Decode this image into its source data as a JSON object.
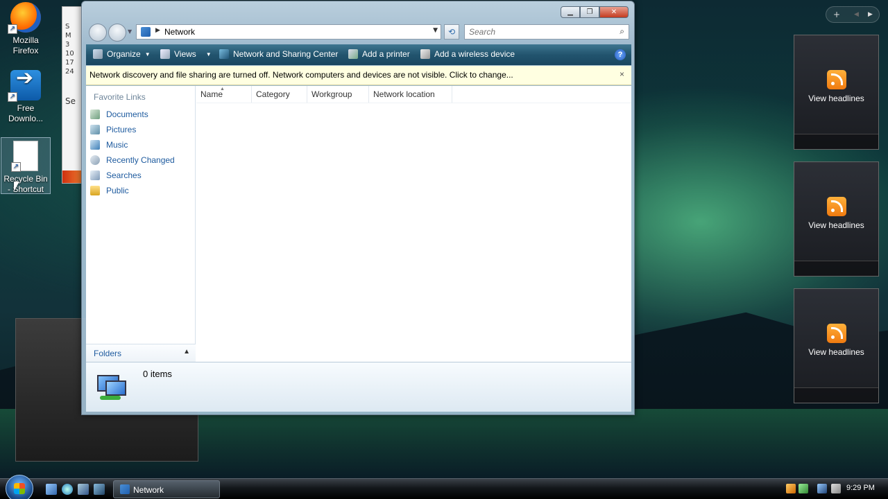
{
  "desktop": {
    "icons": [
      {
        "label": "Mozilla Firefox"
      },
      {
        "label": "Free Downlo..."
      },
      {
        "label": "Recycle Bin - Shortcut"
      }
    ],
    "calendar_strip": [
      "S",
      "M",
      "3",
      "10",
      "17",
      "24",
      "Se"
    ]
  },
  "gadgets": {
    "controls": {
      "add": "+",
      "prev": "◀",
      "next": "▶"
    },
    "feeds": [
      {
        "label": "View headlines"
      },
      {
        "label": "View headlines"
      },
      {
        "label": "View headlines"
      }
    ]
  },
  "window": {
    "caption": {
      "minimize": "▁",
      "maximize": "❐",
      "close": "✕"
    },
    "address": {
      "crumb": "Network"
    },
    "search": {
      "placeholder": "Search"
    },
    "toolbar": {
      "organize": "Organize",
      "views": "Views",
      "network_center": "Network and Sharing Center",
      "add_printer": "Add a printer",
      "add_wireless": "Add a wireless device",
      "help": "?"
    },
    "infobar": {
      "message": "Network discovery and file sharing are turned off. Network computers and devices are not visible. Click to change...",
      "close": "×"
    },
    "nav_pane": {
      "title": "Favorite Links",
      "links": [
        {
          "label": "Documents"
        },
        {
          "label": "Pictures"
        },
        {
          "label": "Music"
        },
        {
          "label": "Recently Changed"
        },
        {
          "label": "Searches"
        },
        {
          "label": "Public"
        }
      ],
      "folders_label": "Folders"
    },
    "columns": [
      {
        "label": "Name"
      },
      {
        "label": "Category"
      },
      {
        "label": "Workgroup"
      },
      {
        "label": "Network location"
      }
    ],
    "details": {
      "count": "0 items"
    }
  },
  "taskbar": {
    "task_label": "Network",
    "clock": "9:29 PM"
  },
  "colors": {
    "toolbar": "#22546e",
    "infobar": "#ffffe1",
    "link": "#1d5a9e"
  }
}
